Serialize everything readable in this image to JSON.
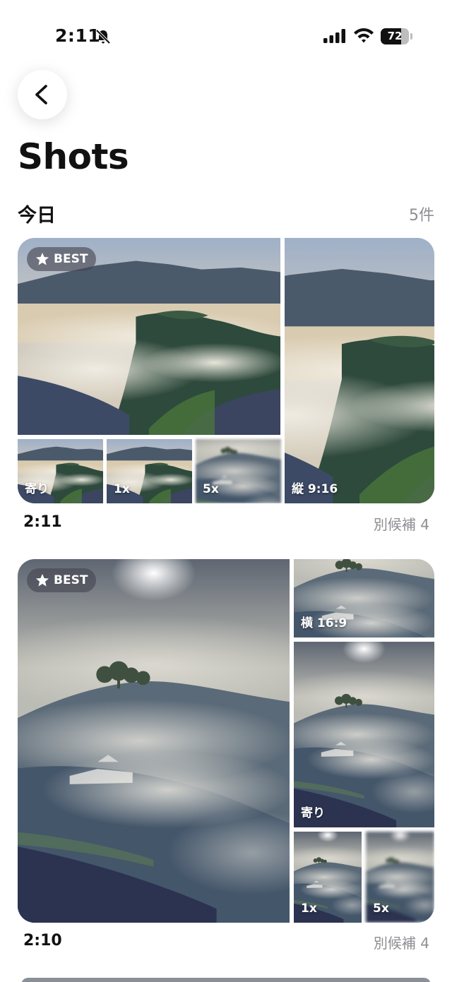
{
  "status": {
    "time": "2:11",
    "battery": "72",
    "battery_level": 0.72
  },
  "page": {
    "title": "Shots"
  },
  "section": {
    "title": "今日",
    "count": "5件"
  },
  "groups": [
    {
      "time": "2:11",
      "alternates": "別候補 4",
      "best_label": "BEST",
      "tiles": [
        "寄り",
        "1x",
        "5x",
        "縦 9:16"
      ]
    },
    {
      "time": "2:10",
      "alternates": "別候補 4",
      "best_label": "BEST",
      "tiles": [
        "横 16:9",
        "寄り",
        "1x",
        "5x"
      ]
    }
  ],
  "icons": {
    "back": "chevron-left-icon",
    "bell": "bell-slash-icon",
    "signal": "cellular-signal-icon",
    "wifi": "wifi-icon",
    "star": "star-icon"
  }
}
